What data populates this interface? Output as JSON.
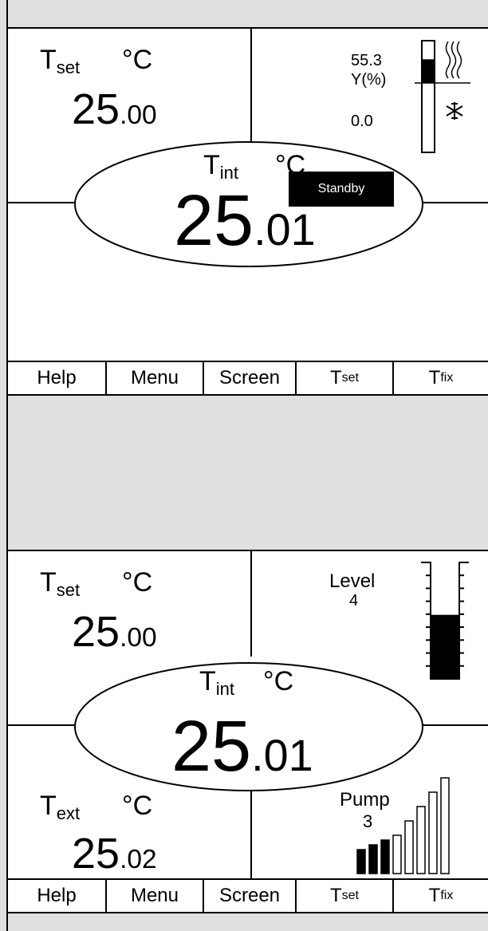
{
  "screen1": {
    "tset_label": "T",
    "tset_sub": "set",
    "tset_unit": "°C",
    "tset_int": "25",
    "tset_dec": ".00",
    "y_value_top": "55.3",
    "y_label": "Y(%)",
    "y_value_bottom": "0.0",
    "tint_label": "T",
    "tint_sub": "int",
    "tint_unit": "°C",
    "tint_int": "25",
    "tint_dec": ".01",
    "status": "Standby",
    "heat_fraction": 0.35,
    "icons": {
      "heat": "heating-waves-icon",
      "cool": "snowflake-icon"
    }
  },
  "screen2": {
    "tset_label": "T",
    "tset_sub": "set",
    "tset_unit": "°C",
    "tset_int": "25",
    "tset_dec": ".00",
    "level_label": "Level",
    "level_value": "4",
    "level_fraction": 0.55,
    "tint_label": "T",
    "tint_sub": "int",
    "tint_unit": "°C",
    "tint_int": "25",
    "tint_dec": ".01",
    "text_label": "T",
    "text_sub": "ext",
    "text_unit": "°C",
    "text_int": "25",
    "text_dec": ".02",
    "pump_label": "Pump",
    "pump_value": "3",
    "pump_level": 3,
    "pump_max": 8
  },
  "softkeys": [
    {
      "label": "Help",
      "sub": ""
    },
    {
      "label": "Menu",
      "sub": ""
    },
    {
      "label": "Screen",
      "sub": ""
    },
    {
      "label": "T",
      "sub": "set"
    },
    {
      "label": "T",
      "sub": "fix"
    }
  ]
}
